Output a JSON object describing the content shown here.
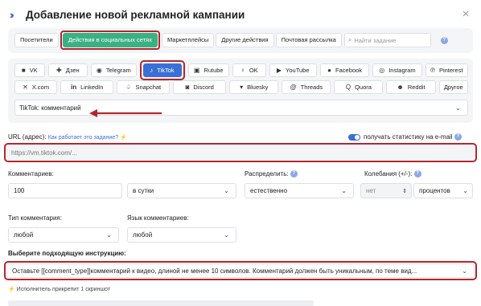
{
  "header": {
    "title": "Добавление новой рекламной кампании",
    "close": "×"
  },
  "top_tabs": {
    "items": [
      "Посетители",
      "Действия в социальных сетях",
      "Маркетплейсы",
      "Другие действия",
      "Почтовая рассылка"
    ],
    "search_placeholder": "Найти задание",
    "help": "?"
  },
  "networks": {
    "row1": [
      {
        "label": "VK",
        "icon": "■"
      },
      {
        "label": "Дзен",
        "icon": "✚"
      },
      {
        "label": "Telegram",
        "icon": "◉"
      },
      {
        "label": "TikTok",
        "icon": "♪"
      },
      {
        "label": "Rutube",
        "icon": "▣"
      },
      {
        "label": "OK",
        "icon": "♀"
      },
      {
        "label": "YouTube",
        "icon": "▶"
      },
      {
        "label": "Facebook",
        "icon": "●"
      },
      {
        "label": "Instagram",
        "icon": "◎"
      },
      {
        "label": "Pinterest",
        "icon": "℗"
      }
    ],
    "row2": [
      {
        "label": "X.com",
        "icon": "✕"
      },
      {
        "label": "LinkedIn",
        "icon": "in"
      },
      {
        "label": "Snapchat",
        "icon": "♤"
      },
      {
        "label": "Discord",
        "icon": "◙"
      },
      {
        "label": "Bluesky",
        "icon": "▾"
      },
      {
        "label": "Threads",
        "icon": "@"
      },
      {
        "label": "Quora",
        "icon": "Q"
      },
      {
        "label": "Reddit",
        "icon": "☻"
      },
      {
        "label": "Другое",
        "icon": ""
      }
    ],
    "selected_task": "TikTok: комментарий"
  },
  "url": {
    "label": "URL (адрес):",
    "help_link": "Как работает это задание?",
    "stats_label": "получать статистику на e-mail",
    "placeholder": "https://vm.tiktok.com/..."
  },
  "comments": {
    "label": "Комментариев:",
    "value": "100",
    "period": "в сутки",
    "distribute_label": "Распределить:",
    "distribute_value": "естественно",
    "fluct_label": "Колебания (+/-):",
    "fluct_value": "нет",
    "fluct_unit": "процентов"
  },
  "type": {
    "label": "Тип комментария:",
    "value": "любой"
  },
  "lang": {
    "label": "Язык комментариев:",
    "value": "любой"
  },
  "instruction": {
    "label": "Выберите подходящую инструкцию:",
    "value": "Оставьте [[comment_type]]комментарий к видео, длиной не менее 10 символов. Комментарий должен быть уникальным, по теме вид..."
  },
  "hint": "Исполнитель прикрепит 1 скриншот",
  "colors": {
    "accent": "#3a6fd8",
    "green": "#3bb083",
    "highlight": "#b3262c"
  }
}
